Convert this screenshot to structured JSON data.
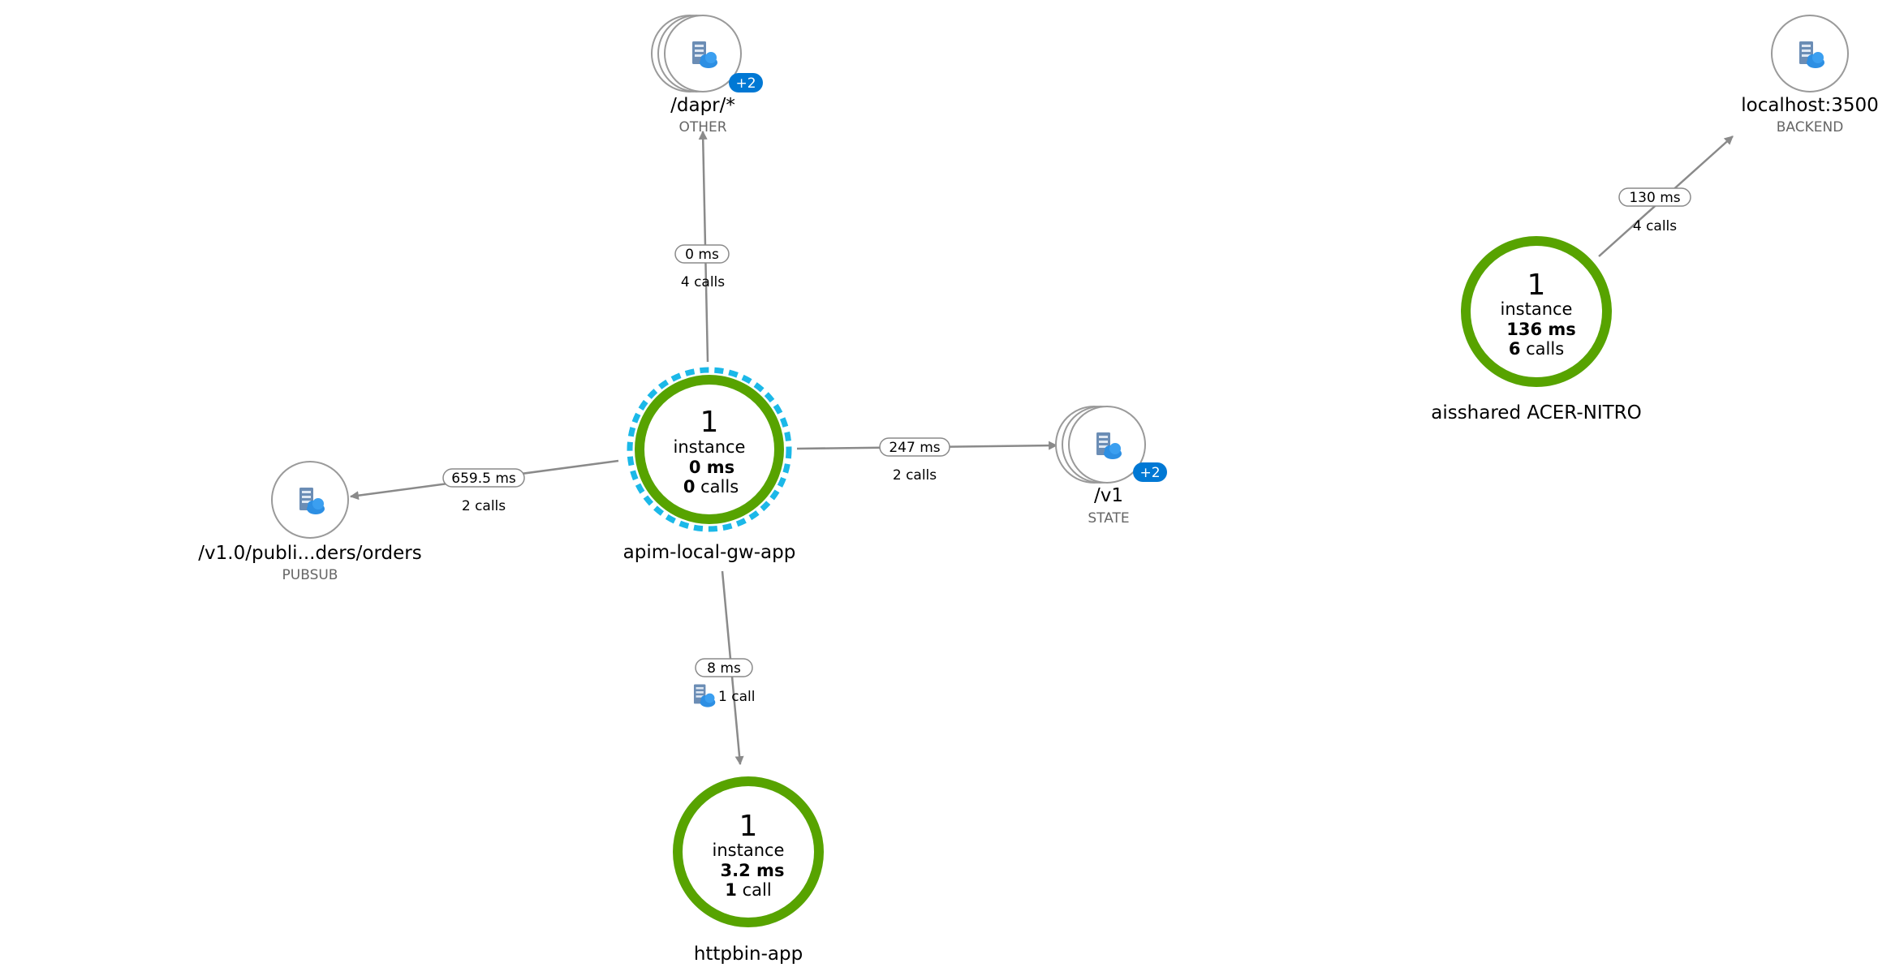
{
  "app_nodes": [
    {
      "id": "gw",
      "count": "1",
      "unit": "instance",
      "duration": "0 ms",
      "calls_num": "0",
      "calls_unit": "calls",
      "name": "apim-local-gw-app",
      "selected": true
    },
    {
      "id": "httpbin",
      "count": "1",
      "unit": "instance",
      "duration": "3.2 ms",
      "calls_num": "1",
      "calls_unit": "call",
      "name": "httpbin-app",
      "selected": false
    },
    {
      "id": "acer",
      "count": "1",
      "unit": "instance",
      "duration": "136 ms",
      "calls_num": "6",
      "calls_unit": "calls",
      "name": "aisshared ACER-NITRO",
      "selected": false
    }
  ],
  "dependency_nodes": [
    {
      "id": "dapr",
      "name": "/dapr/*",
      "type": "OTHER",
      "badge": "+2",
      "icon": "server-cloud-icon"
    },
    {
      "id": "v1",
      "name": "/v1",
      "type": "STATE",
      "badge": "+2",
      "icon": "server-cloud-icon"
    },
    {
      "id": "pubsub",
      "name": "/v1.0/publi...ders/orders",
      "type": "PUBSUB",
      "badge": "",
      "icon": "server-cloud-icon"
    },
    {
      "id": "localhost",
      "name": "localhost:3500",
      "type": "BACKEND",
      "badge": "",
      "icon": "server-cloud-icon"
    }
  ],
  "edges": [
    {
      "id": "gw-dapr",
      "from": "gw",
      "to": "dapr",
      "duration": "0 ms",
      "calls": "4 calls",
      "icon": ""
    },
    {
      "id": "gw-v1",
      "from": "gw",
      "to": "v1",
      "duration": "247 ms",
      "calls": "2 calls",
      "icon": ""
    },
    {
      "id": "gw-pubsub",
      "from": "gw",
      "to": "pubsub",
      "duration": "659.5 ms",
      "calls": "2 calls",
      "icon": ""
    },
    {
      "id": "gw-httpbin",
      "from": "gw",
      "to": "httpbin",
      "duration": "8 ms",
      "calls": "1 call",
      "icon": "server-cloud-icon"
    },
    {
      "id": "acer-localhost",
      "from": "acer",
      "to": "localhost",
      "duration": "130 ms",
      "calls": "4 calls",
      "icon": ""
    }
  ],
  "colors": {
    "healthy_ring": "#57a300",
    "selected_ring": "#1bb8e8",
    "edge": "#8a8a8a",
    "badge": "#0078d4",
    "dependency_border": "#9a9a9a",
    "cloud": "#2d8fe3",
    "server": "#6b8db5"
  }
}
